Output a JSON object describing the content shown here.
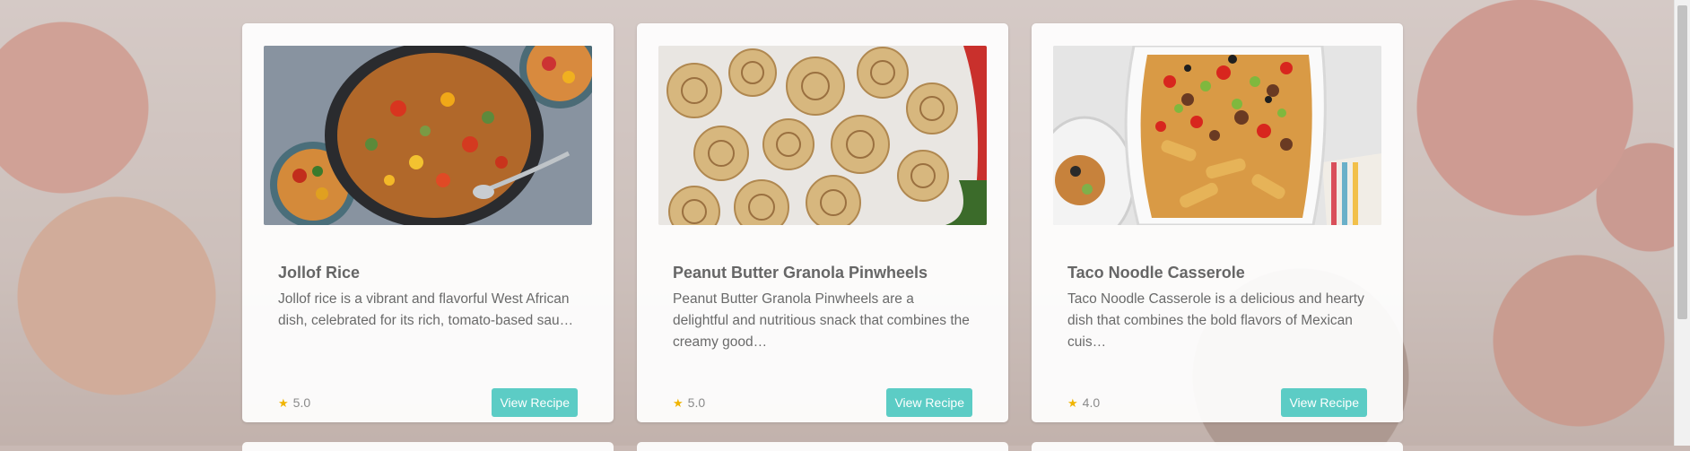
{
  "cards": [
    {
      "title": "Jollof Rice",
      "description": "Jollof rice is a vibrant and flavorful West African dish, celebrated for its rich, tomato-based sau…",
      "rating": "5.0",
      "button_label": "View Recipe",
      "image_icon": "jollof-rice-photo"
    },
    {
      "title": "Peanut Butter Granola Pinwheels",
      "description": "Peanut Butter Granola Pinwheels are a delightful and nutritious snack that combines the creamy good…",
      "rating": "5.0",
      "button_label": "View Recipe",
      "image_icon": "pinwheels-photo"
    },
    {
      "title": "Taco Noodle Casserole",
      "description": "Taco Noodle Casserole is a delicious and hearty dish that combines the bold flavors of Mexican cuis…",
      "rating": "4.0",
      "button_label": "View Recipe",
      "image_icon": "casserole-photo"
    }
  ],
  "star_glyph": "★",
  "colors": {
    "button": "#5cccc5",
    "star": "#f0b400",
    "title": "#666666"
  }
}
